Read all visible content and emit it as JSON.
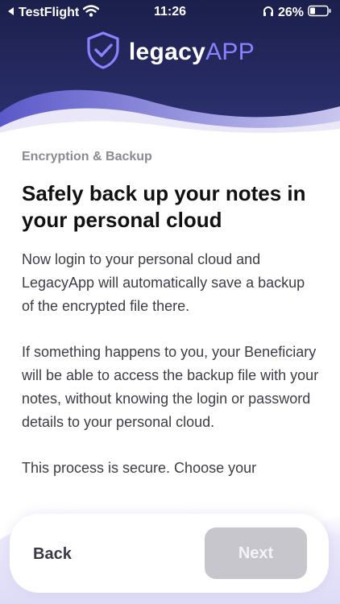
{
  "status_bar": {
    "back_app": "TestFlight",
    "time": "11:26",
    "battery": "26%"
  },
  "brand": {
    "name_part1": "legacy",
    "name_part2": "APP",
    "logo_icon": "shield-check-icon"
  },
  "content": {
    "eyebrow": "Encryption & Backup",
    "title": "Safely back up your notes in your personal cloud",
    "paragraphs": [
      "Now login to your personal cloud and LegacyApp will automatically save a backup of the encrypted file there.",
      "If something happens to you, your Beneficiary will be able to access the backup file with your notes, without knowing the login or password details to your personal cloud.",
      "This process is secure. Choose your"
    ]
  },
  "footer": {
    "back_label": "Back",
    "next_label": "Next",
    "next_enabled": false
  },
  "colors": {
    "header_dark": "#1f2352",
    "accent": "#8b82ff",
    "wave_light": "#e3e1f6",
    "next_disabled": "#c6c6cc"
  }
}
